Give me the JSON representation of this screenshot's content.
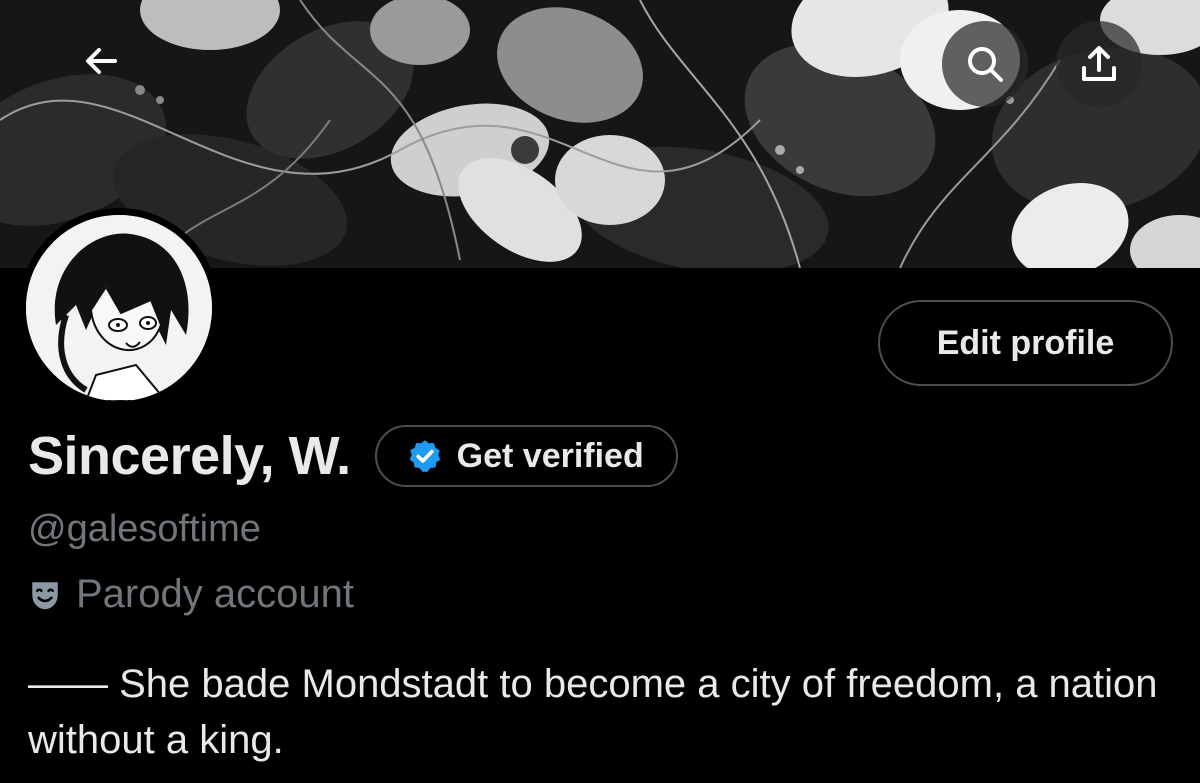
{
  "header": {
    "back_icon": "arrow-left-icon",
    "search_icon": "search-icon",
    "share_icon": "share-upload-icon"
  },
  "profile": {
    "display_name": "Sincerely, W.",
    "verify_label": "Get verified",
    "verify_icon": "verified-badge-icon",
    "handle": "@galesoftime",
    "parody_icon": "theater-mask-icon",
    "parody_label": "Parody account",
    "bio": "—— She bade Mondstadt to become a city of freedom, a nation without a king.",
    "edit_button_label": "Edit profile"
  },
  "colors": {
    "background": "#000000",
    "primary_text": "#e7e9ea",
    "secondary_text": "#71767b",
    "border": "#4a4f54",
    "verified_blue": "#1d9bf0"
  }
}
